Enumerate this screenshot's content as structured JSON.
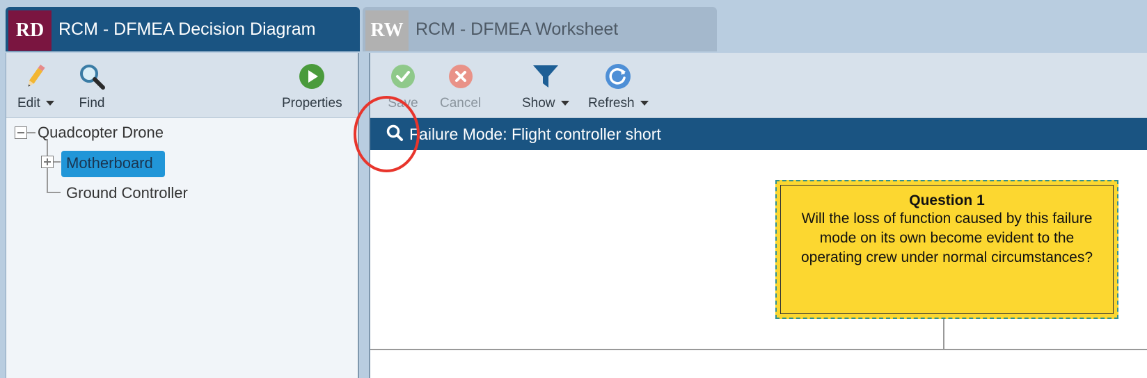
{
  "tabs": [
    {
      "badge": "RD",
      "title": "RCM - DFMEA Decision Diagram"
    },
    {
      "badge": "RW",
      "title": "RCM - DFMEA Worksheet"
    }
  ],
  "left_toolbar": {
    "edit_label": "Edit",
    "find_label": "Find",
    "properties_label": "Properties"
  },
  "tree": {
    "root": "Quadcopter Drone",
    "children": [
      "Motherboard",
      "Ground Controller"
    ]
  },
  "right_toolbar": {
    "save_label": "Save",
    "cancel_label": "Cancel",
    "show_label": "Show",
    "refresh_label": "Refresh"
  },
  "failure_mode": "Failure Mode: Flight controller short",
  "question": {
    "title": "Question 1",
    "text": "Will the loss of function caused by this failure mode on its own become evident to the operating crew under normal circumstances?"
  },
  "colors": {
    "header_blue": "#1a5482",
    "badge_rd": "#7a1540",
    "selection": "#2196d8",
    "question_fill": "#fcd730",
    "highlight": "#e8352c"
  }
}
